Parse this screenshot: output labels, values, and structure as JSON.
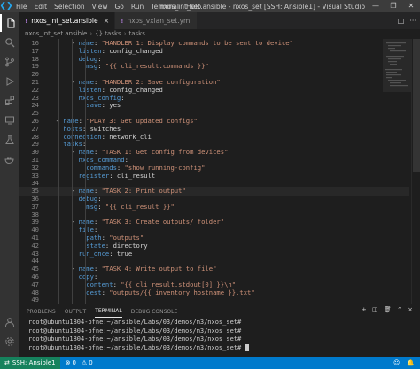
{
  "app": {
    "menu": [
      "File",
      "Edit",
      "Selection",
      "View",
      "Go",
      "Run",
      "Terminal",
      "Help"
    ],
    "window_title": "nxos_int_set.ansible - nxos_set [SSH: Ansible1] - Visual Studio Code [Administrator]",
    "window_controls": [
      "—",
      "❐",
      "✕"
    ]
  },
  "tabs": [
    {
      "label": "nxos_int_set.ansible",
      "active": true
    },
    {
      "label": "nxos_vxlan_set.yml",
      "active": false
    }
  ],
  "breadcrumb": [
    "nxos_int_set.ansible",
    "{} tasks",
    "tasks"
  ],
  "editor": {
    "lines": [
      {
        "n": "16",
        "t": "      - name: \"HANDLER 1: Display commands to be sent to device\""
      },
      {
        "n": "17",
        "t": "        listen: config_changed"
      },
      {
        "n": "18",
        "t": "        debug:"
      },
      {
        "n": "19",
        "t": "          msg: \"{{ cli_result.commands }}\""
      },
      {
        "n": "20",
        "t": ""
      },
      {
        "n": "21",
        "t": "      - name: \"HANDLER 2: Save configuration\""
      },
      {
        "n": "22",
        "t": "        listen: config_changed"
      },
      {
        "n": "23",
        "t": "        nxos_config:"
      },
      {
        "n": "24",
        "t": "          save: yes"
      },
      {
        "n": "25",
        "t": ""
      },
      {
        "n": "26",
        "t": "  - name: \"PLAY 3: Get updated configs\""
      },
      {
        "n": "27",
        "t": "    hosts: switches"
      },
      {
        "n": "28",
        "t": "    connection: network_cli"
      },
      {
        "n": "29",
        "t": "    tasks:"
      },
      {
        "n": "30",
        "t": "      - name: \"TASK 1: Get config from devices\""
      },
      {
        "n": "31",
        "t": "        nxos_command:"
      },
      {
        "n": "32",
        "t": "          commands: \"show running-config\""
      },
      {
        "n": "33",
        "t": "        register: cli_result"
      },
      {
        "n": "34",
        "t": ""
      },
      {
        "n": "35",
        "t": "      - name: \"TASK 2: Print output\""
      },
      {
        "n": "36",
        "t": "        debug:"
      },
      {
        "n": "37",
        "t": "          msg: \"{{ cli_result }}\""
      },
      {
        "n": "38",
        "t": ""
      },
      {
        "n": "39",
        "t": "      - name: \"TASK 3: Create outputs/ folder\""
      },
      {
        "n": "40",
        "t": "        file:"
      },
      {
        "n": "41",
        "t": "          path: \"outputs\""
      },
      {
        "n": "42",
        "t": "          state: directory"
      },
      {
        "n": "43",
        "t": "        run_once: true"
      },
      {
        "n": "44",
        "t": ""
      },
      {
        "n": "45",
        "t": "      - name: \"TASK 4: Write output to file\""
      },
      {
        "n": "46",
        "t": "        copy:"
      },
      {
        "n": "47",
        "t": "          content: \"{{ cli_result.stdout[0] }}\\n\""
      },
      {
        "n": "48",
        "t": "          dest: \"outputs/{{ inventory_hostname }}.txt\""
      },
      {
        "n": "49",
        "t": ""
      }
    ]
  },
  "panel": {
    "tabs": [
      "PROBLEMS",
      "OUTPUT",
      "TERMINAL",
      "DEBUG CONSOLE"
    ],
    "active_tab": "TERMINAL",
    "terminal_lines": [
      "root@ubuntu1804-pfne:~/ansible/Labs/03/demos/m3/nxos_set#",
      "root@ubuntu1804-pfne:~/ansible/Labs/03/demos/m3/nxos_set#",
      "root@ubuntu1804-pfne:~/ansible/Labs/03/demos/m3/nxos_set#",
      "root@ubuntu1804-pfne:~/ansible/Labs/03/demos/m3/nxos_set# "
    ]
  },
  "status": {
    "remote": "SSH: Ansible1",
    "errors": "0",
    "warnings": "0"
  },
  "colors": {
    "accent": "#007acc",
    "remote": "#16825d",
    "keyword": "#569cd6",
    "string": "#ce9178"
  }
}
